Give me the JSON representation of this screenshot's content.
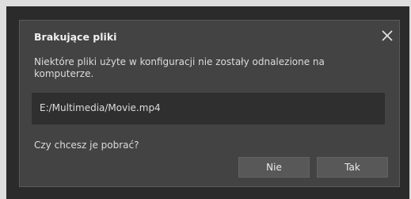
{
  "dialog": {
    "title": "Brakujące pliki",
    "message": "Niektóre pliki użyte w konfiguracji nie zostały odnalezione na komputerze.",
    "missing_files": [
      "E:/Multimedia/Movie.mp4"
    ],
    "question": "Czy chcesz je pobrać?",
    "buttons": {
      "no_label": "Nie",
      "yes_label": "Tak"
    },
    "close_icon": "close-icon"
  },
  "colors": {
    "page_background": "#dedede",
    "backdrop": "#2b2b2b",
    "dialog_background": "#434343",
    "path_box": "#2f2f2f",
    "button": "#585858",
    "text": "#dcdcdc"
  }
}
